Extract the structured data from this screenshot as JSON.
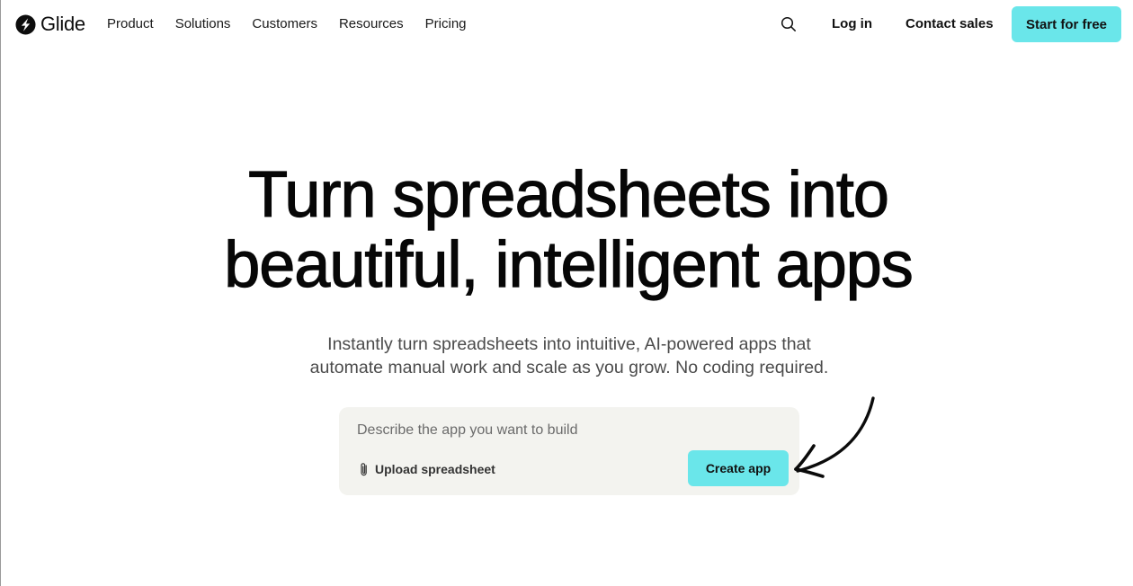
{
  "brand": {
    "name": "Glide",
    "logo_icon": "bolt-circle-icon"
  },
  "nav": {
    "menu": [
      {
        "label": "Product"
      },
      {
        "label": "Solutions"
      },
      {
        "label": "Customers"
      },
      {
        "label": "Resources"
      },
      {
        "label": "Pricing"
      }
    ],
    "search_icon": "search-icon",
    "login_label": "Log in",
    "contact_label": "Contact sales",
    "start_label": "Start for free"
  },
  "hero": {
    "title_line1": "Turn spreadsheets into",
    "title_line2": "beautiful, intelligent apps",
    "subtitle_line1": "Instantly turn spreadsheets into intuitive, AI-powered apps that",
    "subtitle_line2": "automate manual work and scale as you grow. No coding required."
  },
  "prompt": {
    "placeholder": "Describe the app you want to build",
    "value": "",
    "upload_icon": "paperclip-icon",
    "upload_label": "Upload spreadsheet",
    "create_label": "Create app",
    "arrow_icon": "hand-drawn-arrow-icon"
  },
  "colors": {
    "accent": "#6ae6ea",
    "prompt_bg": "#f3f3ef",
    "text": "#111111",
    "muted": "#4b4b4b"
  }
}
